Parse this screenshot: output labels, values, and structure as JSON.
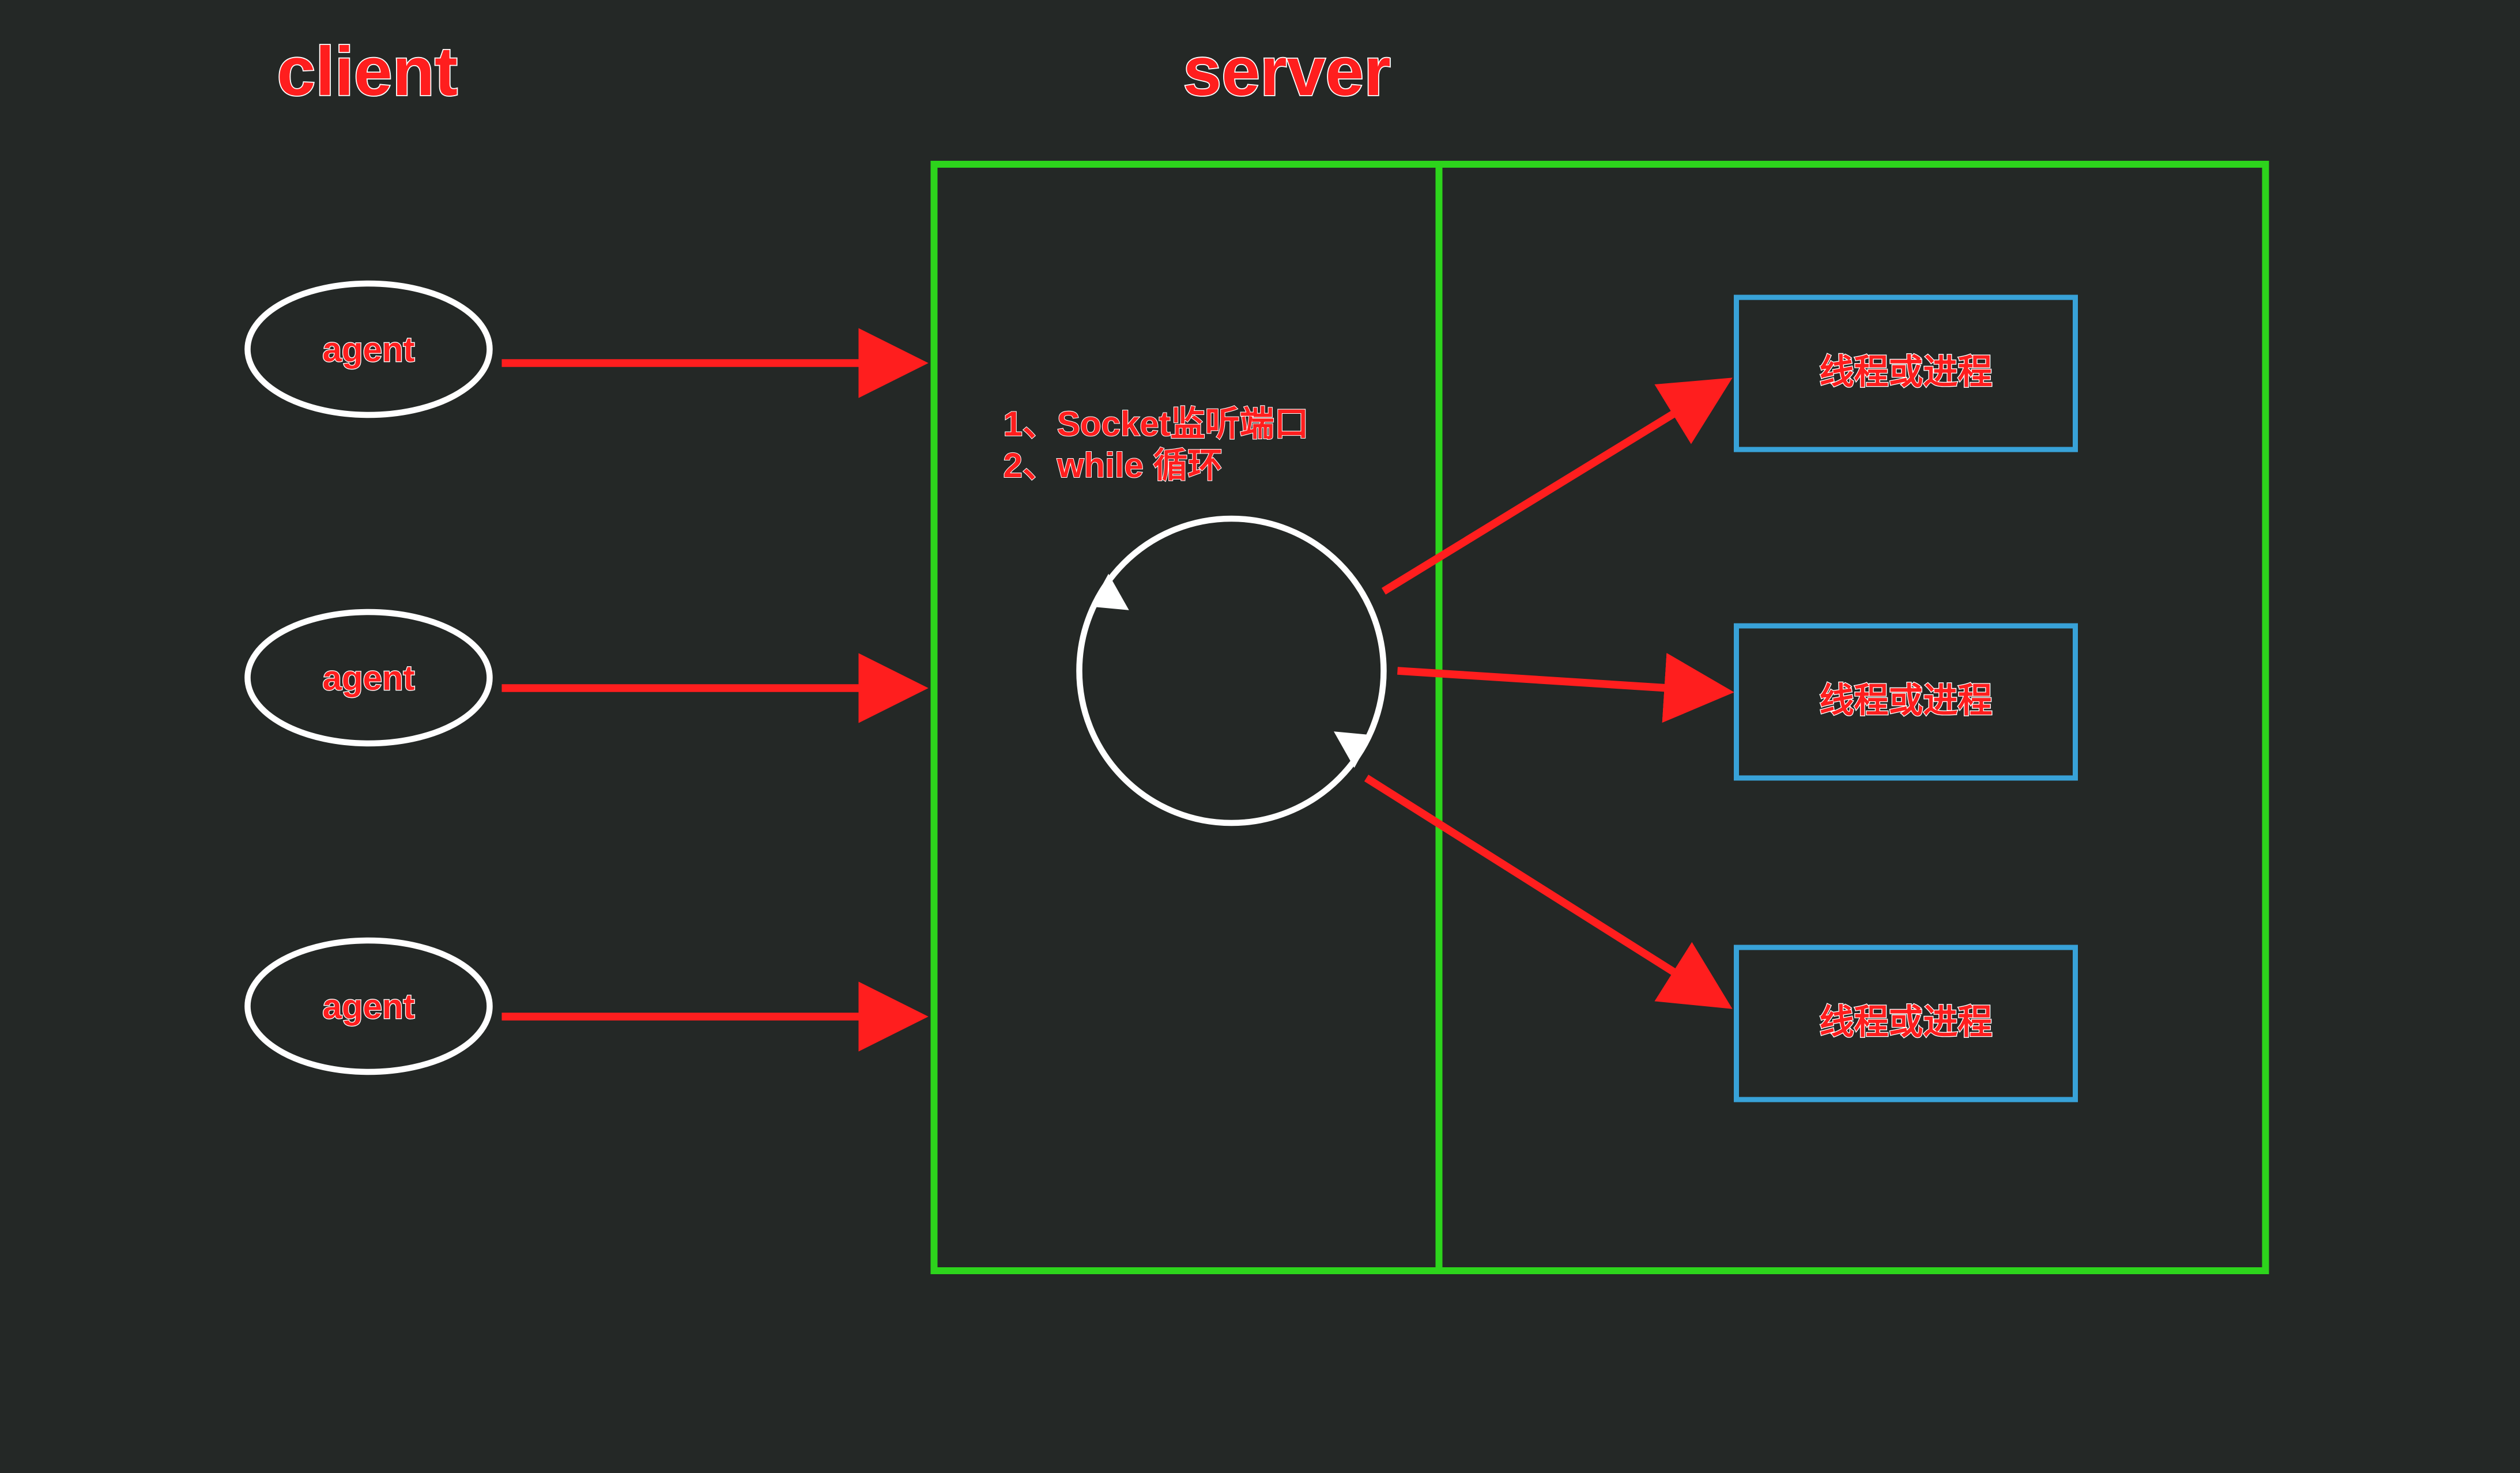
{
  "titles": {
    "client": "client",
    "server": "server"
  },
  "agents": [
    {
      "label": "agent"
    },
    {
      "label": "agent"
    },
    {
      "label": "agent"
    }
  ],
  "loop": {
    "line1": "1、Socket监听端口",
    "line2": "2、while 循环"
  },
  "workers": [
    {
      "label": "线程或进程"
    },
    {
      "label": "线程或进程"
    },
    {
      "label": "线程或进程"
    }
  ]
}
